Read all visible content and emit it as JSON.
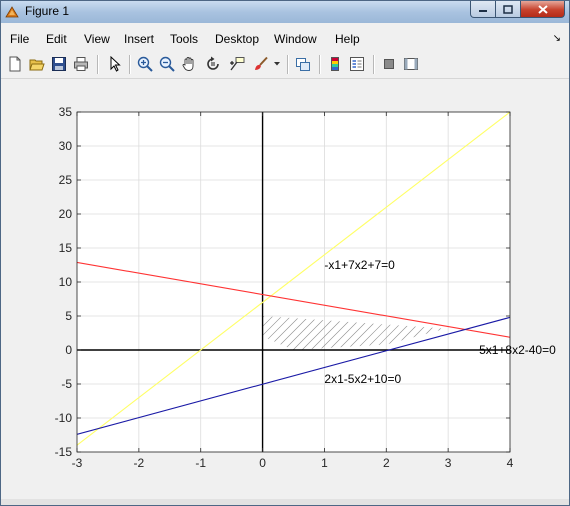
{
  "window": {
    "title": "Figure 1"
  },
  "menu": [
    "File",
    "Edit",
    "View",
    "Insert",
    "Tools",
    "Desktop",
    "Window",
    "Help"
  ],
  "toolbar": {
    "buttons": [
      "new-figure",
      "open-file",
      "save-figure",
      "print-figure",
      "edit-plot",
      "zoom-in",
      "zoom-out",
      "pan",
      "rotate-3d",
      "data-cursor",
      "brush",
      "brush-dropdown",
      "link-plot",
      "insert-colorbar",
      "insert-legend",
      "hide-plot-tools",
      "show-plot-tools"
    ]
  },
  "colors": {
    "line_yellow": "#ffff66",
    "line_red": "#ff3333",
    "line_blue": "#1a1aa6",
    "axes_lines": "#000000"
  },
  "chart_data": {
    "type": "line",
    "title": "",
    "xlabel": "",
    "ylabel": "",
    "xlim": [
      -3,
      4
    ],
    "ylim": [
      -15,
      35
    ],
    "xticks": [
      -3,
      -2,
      -1,
      0,
      1,
      2,
      3,
      4
    ],
    "yticks": [
      -15,
      -10,
      -5,
      0,
      5,
      10,
      15,
      20,
      25,
      30,
      35
    ],
    "grid": true,
    "series": [
      {
        "color": "#ffff66",
        "x": [
          -3,
          4
        ],
        "y": [
          -14,
          35
        ]
      },
      {
        "color": "#ff3333",
        "x": [
          -3,
          4
        ],
        "y": [
          12.875,
          1.875
        ]
      },
      {
        "color": "#1a1aa6",
        "x": [
          -3,
          4
        ],
        "y": [
          -12.4,
          4.8
        ]
      }
    ],
    "annotations": [
      {
        "text": "-x1+7x2+7=0",
        "x": 1.0,
        "y": 12.5
      },
      {
        "text": "5x1+8x2-40=0",
        "x": 3.5,
        "y": 0
      },
      {
        "text": "2x1-5x2+10=0",
        "x": 1.0,
        "y": -4.3
      }
    ],
    "feasible_region": [
      [
        0,
        2
      ],
      [
        0,
        5
      ],
      [
        2.96,
        3.15
      ],
      [
        2,
        0.8
      ],
      [
        0.5,
        0
      ]
    ]
  }
}
